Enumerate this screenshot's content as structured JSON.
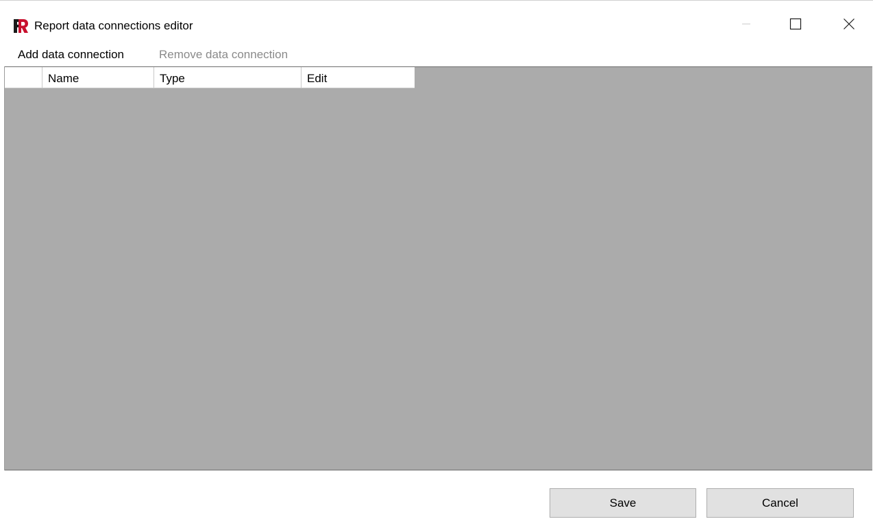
{
  "window": {
    "title": "Report data connections editor",
    "app_icon": "fastreport-logo-icon",
    "controls": [
      "minimize-icon",
      "maximize-icon",
      "close-icon"
    ]
  },
  "menu": {
    "add_label": "Add data connection",
    "remove_label": "Remove data connection",
    "remove_enabled": false
  },
  "grid": {
    "columns": [
      "",
      "Name",
      "Type",
      "Edit"
    ],
    "rows": [],
    "background_color": "#ababab"
  },
  "buttons": {
    "save_label": "Save",
    "cancel_label": "Cancel"
  },
  "colors": {
    "logo_dark": "#1a1a1a",
    "logo_red": "#c8102e",
    "disabled_text": "#8a8a8a",
    "button_face": "#e1e1e1"
  }
}
